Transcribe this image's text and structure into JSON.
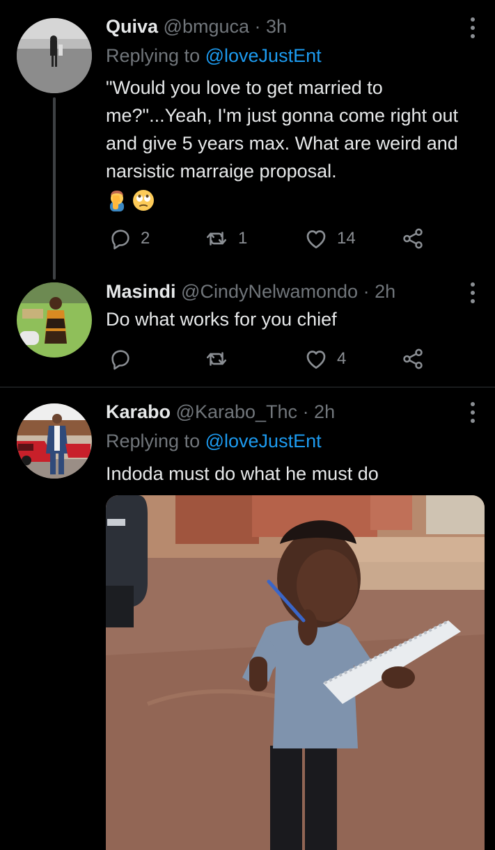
{
  "tweets": [
    {
      "name": "Quiva",
      "handle": "@bmguca",
      "time": "· 3h",
      "replying_prefix": "Replying to",
      "replying_to": "@loveJustEnt",
      "text": "\"Would you love to get married to me?\"...Yeah, I'm just gonna come right out and give 5 years max. What are weird and narsistic marraige proposal.",
      "emojis": [
        "man-facepalming-emoji",
        "face-with-rolling-eyes-emoji"
      ],
      "stats": {
        "replies": "2",
        "retweets": "1",
        "likes": "14"
      }
    },
    {
      "name": "Masindi",
      "handle": "@CindyNelwamondo",
      "time": "· 2h",
      "text": "Do what works for you chief",
      "stats": {
        "replies": "",
        "retweets": "",
        "likes": "4"
      }
    },
    {
      "name": "Karabo",
      "handle": "@Karabo_Thc",
      "time": "· 2h",
      "replying_prefix": "Replying to",
      "replying_to": "@loveJustEnt",
      "text": "Indoda must do what he must do",
      "media": "photo of a toddler in a blue t-shirt holding a pen and a notepad on a brick driveway"
    }
  ],
  "icons": {
    "reply": "reply-icon",
    "retweet": "retweet-icon",
    "like": "heart-icon",
    "share": "share-icon",
    "more": "more-options-icon"
  },
  "colors": {
    "background": "#000000",
    "text": "#e7e9ea",
    "secondary": "#71767b",
    "link": "#1d9bf0",
    "divider": "#2f3336"
  }
}
